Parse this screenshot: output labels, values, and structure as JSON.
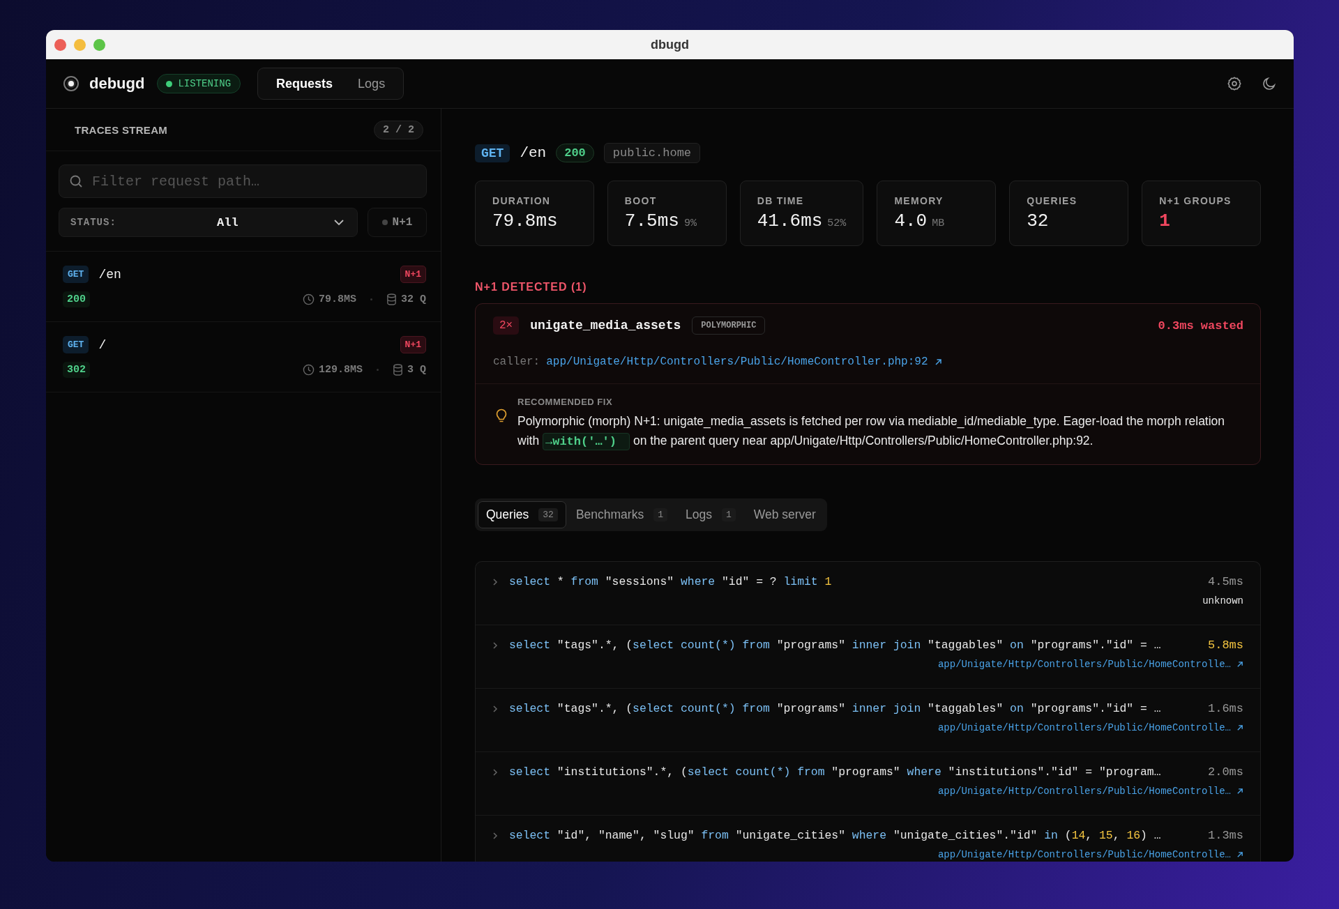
{
  "window": {
    "title": "dbugd"
  },
  "app": {
    "name": "debugd",
    "status": "LISTENING"
  },
  "nav_tabs": [
    {
      "label": "Requests",
      "selected": true
    },
    {
      "label": "Logs",
      "selected": false
    }
  ],
  "sidebar": {
    "title": "TRACES STREAM",
    "count": "2 / 2",
    "search": {
      "placeholder": "Filter request path…"
    },
    "status_filter": {
      "label": "STATUS:",
      "value": "All"
    },
    "n1_toggle": {
      "label": "N+1",
      "on": false
    },
    "requests": [
      {
        "method": "GET",
        "path": "/en",
        "status": "200",
        "badge": "N+1",
        "duration": "79.8MS",
        "queries": "32 Q"
      },
      {
        "method": "GET",
        "path": "/",
        "status": "302",
        "badge": "N+1",
        "duration": "129.8MS",
        "queries": "3 Q"
      }
    ]
  },
  "detail": {
    "method": "GET",
    "path": "/en",
    "status": "200",
    "route": "public.home",
    "stats": [
      {
        "label": "DURATION",
        "value": "79.8ms",
        "alert": false
      },
      {
        "label": "BOOT",
        "value": "7.5ms",
        "unit": "9%",
        "alert": false
      },
      {
        "label": "DB TIME",
        "value": "41.6ms",
        "unit": "52%",
        "alert": false
      },
      {
        "label": "MEMORY",
        "value": "4.0",
        "unit": "MB",
        "alert": false
      },
      {
        "label": "QUERIES",
        "value": "32",
        "alert": false
      },
      {
        "label": "N+1 GROUPS",
        "value": "1",
        "alert": true
      }
    ],
    "n1": {
      "heading": "N+1 DETECTED (1)",
      "count": "2×",
      "table": "unigate_media_assets",
      "tag": "POLYMORPHIC",
      "wasted": "0.3ms wasted",
      "caller_label": "caller:",
      "caller": "app/Unigate/Http/Controllers/Public/HomeController.php:92",
      "fix_label": "RECOMMENDED FIX",
      "fix_before": "Polymorphic (morph) N+1: unigate_media_assets is fetched per row via mediable_id/mediable_type. Eager-load the morph relation with",
      "fix_code": "→with('…')",
      "fix_after": "on the parent query near app/Unigate/Http/Controllers/Public/HomeController.php:92."
    },
    "tabs": [
      {
        "label": "Queries",
        "count": "32",
        "selected": true
      },
      {
        "label": "Benchmarks",
        "count": "1",
        "selected": false
      },
      {
        "label": "Logs",
        "count": "1",
        "selected": false
      },
      {
        "label": "Web server",
        "selected": false
      }
    ],
    "queries": [
      {
        "tokens": [
          {
            "kind": "kw",
            "text": "select"
          },
          {
            "kind": "text",
            "text": " * "
          },
          {
            "kind": "kw",
            "text": "from"
          },
          {
            "kind": "text",
            "text": " \"sessions\" "
          },
          {
            "kind": "kw",
            "text": "where"
          },
          {
            "kind": "text",
            "text": " \"id\" = ? "
          },
          {
            "kind": "kw",
            "text": "limit"
          },
          {
            "kind": "num",
            "text": " 1"
          }
        ],
        "time": "4.5ms",
        "slow": false,
        "source": {
          "kind": "plain",
          "text": "unknown"
        }
      },
      {
        "tokens": [
          {
            "kind": "kw",
            "text": "select"
          },
          {
            "kind": "text",
            "text": " \"tags\".*, ("
          },
          {
            "kind": "kw",
            "text": "select count(*) from"
          },
          {
            "kind": "text",
            "text": " \"programs\" "
          },
          {
            "kind": "kw",
            "text": "inner join"
          },
          {
            "kind": "text",
            "text": " \"taggables\" "
          },
          {
            "kind": "kw",
            "text": "on"
          },
          {
            "kind": "text",
            "text": " \"programs\".\"id\" = …"
          }
        ],
        "time": "5.8ms",
        "slow": true,
        "source": {
          "kind": "link",
          "text": "app/Unigate/Http/Controllers/Public/HomeControlle…"
        }
      },
      {
        "tokens": [
          {
            "kind": "kw",
            "text": "select"
          },
          {
            "kind": "text",
            "text": " \"tags\".*, ("
          },
          {
            "kind": "kw",
            "text": "select count(*) from"
          },
          {
            "kind": "text",
            "text": " \"programs\" "
          },
          {
            "kind": "kw",
            "text": "inner join"
          },
          {
            "kind": "text",
            "text": " \"taggables\" "
          },
          {
            "kind": "kw",
            "text": "on"
          },
          {
            "kind": "text",
            "text": " \"programs\".\"id\" = …"
          }
        ],
        "time": "1.6ms",
        "slow": false,
        "source": {
          "kind": "link",
          "text": "app/Unigate/Http/Controllers/Public/HomeControlle…"
        }
      },
      {
        "tokens": [
          {
            "kind": "kw",
            "text": "select"
          },
          {
            "kind": "text",
            "text": " \"institutions\".*, ("
          },
          {
            "kind": "kw",
            "text": "select count(*) from"
          },
          {
            "kind": "text",
            "text": " \"programs\" "
          },
          {
            "kind": "kw",
            "text": "where"
          },
          {
            "kind": "text",
            "text": " \"institutions\".\"id\" = \"program…"
          }
        ],
        "time": "2.0ms",
        "slow": false,
        "source": {
          "kind": "link",
          "text": "app/Unigate/Http/Controllers/Public/HomeControlle…"
        }
      },
      {
        "tokens": [
          {
            "kind": "kw",
            "text": "select"
          },
          {
            "kind": "text",
            "text": " \"id\", \"name\", \"slug\" "
          },
          {
            "kind": "kw",
            "text": "from"
          },
          {
            "kind": "text",
            "text": " \"unigate_cities\" "
          },
          {
            "kind": "kw",
            "text": "where"
          },
          {
            "kind": "text",
            "text": " \"unigate_cities\".\"id\" "
          },
          {
            "kind": "kw",
            "text": "in"
          },
          {
            "kind": "text",
            "text": " ("
          },
          {
            "kind": "num",
            "text": "14"
          },
          {
            "kind": "text",
            "text": ", "
          },
          {
            "kind": "num",
            "text": "15"
          },
          {
            "kind": "text",
            "text": ", "
          },
          {
            "kind": "num",
            "text": "16"
          },
          {
            "kind": "text",
            "text": ") …"
          }
        ],
        "time": "1.3ms",
        "slow": false,
        "source": {
          "kind": "link",
          "text": "app/Unigate/Http/Controllers/Public/HomeControlle…"
        }
      }
    ]
  }
}
